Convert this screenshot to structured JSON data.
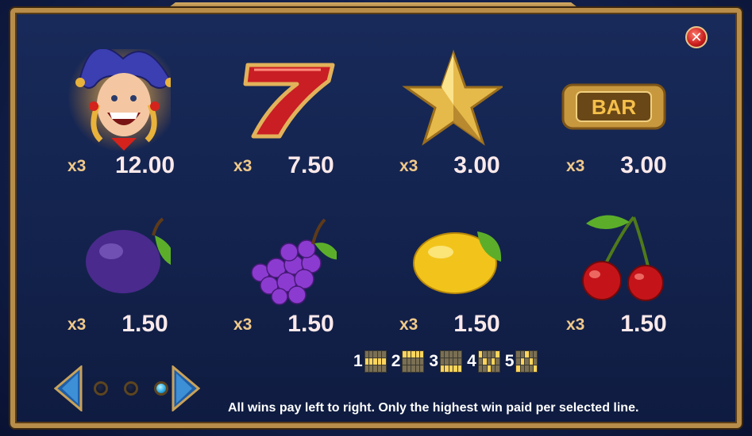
{
  "close_button": {
    "symbol": "✕"
  },
  "paytable": [
    {
      "symbol": "jester-icon",
      "multiplier": "x3",
      "payout": "12.00"
    },
    {
      "symbol": "seven-icon",
      "multiplier": "x3",
      "payout": "7.50"
    },
    {
      "symbol": "star-icon",
      "multiplier": "x3",
      "payout": "3.00"
    },
    {
      "symbol": "bar-icon",
      "multiplier": "x3",
      "payout": "3.00",
      "bar_text": "BAR"
    },
    {
      "symbol": "plum-icon",
      "multiplier": "x3",
      "payout": "1.50"
    },
    {
      "symbol": "grapes-icon",
      "multiplier": "x3",
      "payout": "1.50"
    },
    {
      "symbol": "lemon-icon",
      "multiplier": "x3",
      "payout": "1.50"
    },
    {
      "symbol": "cherries-icon",
      "multiplier": "x3",
      "payout": "1.50"
    }
  ],
  "paylines": [
    {
      "number": "1",
      "pattern": [
        0,
        0,
        0,
        0,
        0,
        1,
        1,
        1,
        1,
        1,
        0,
        0,
        0,
        0,
        0
      ]
    },
    {
      "number": "2",
      "pattern": [
        1,
        1,
        1,
        1,
        1,
        0,
        0,
        0,
        0,
        0,
        0,
        0,
        0,
        0,
        0
      ]
    },
    {
      "number": "3",
      "pattern": [
        0,
        0,
        0,
        0,
        0,
        0,
        0,
        0,
        0,
        0,
        1,
        1,
        1,
        1,
        1
      ]
    },
    {
      "number": "4",
      "pattern": [
        1,
        0,
        0,
        0,
        1,
        0,
        1,
        0,
        1,
        0,
        0,
        0,
        1,
        0,
        0
      ]
    },
    {
      "number": "5",
      "pattern": [
        0,
        0,
        1,
        0,
        0,
        0,
        1,
        0,
        1,
        0,
        1,
        0,
        0,
        0,
        1
      ]
    }
  ],
  "footer_text": "All wins pay left to right. Only the highest win paid per selected line.",
  "pagination": {
    "pages": 3,
    "current": 3
  }
}
